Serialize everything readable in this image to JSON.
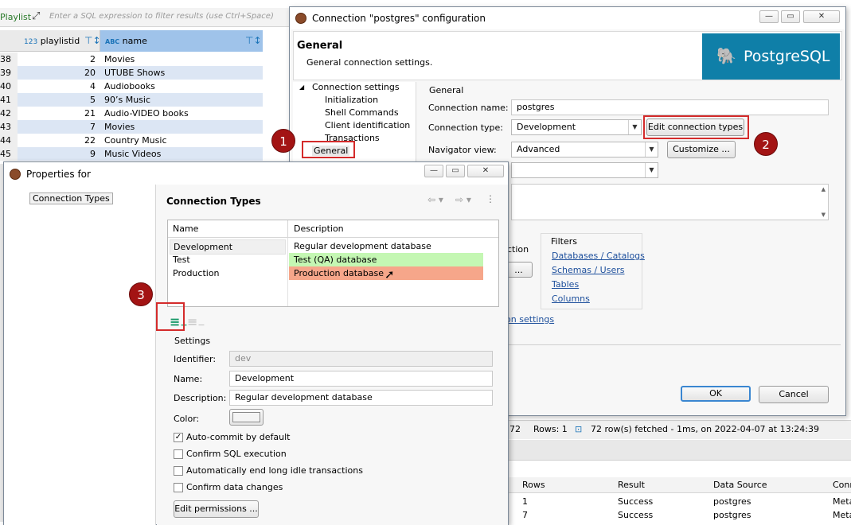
{
  "bg": {
    "playlist_tab": "Playlist",
    "filter_placeholder": "Enter a SQL expression to filter results (use Ctrl+Space)",
    "col_playlistid_type": "123",
    "col_playlistid": "playlistid",
    "col_name_type": "ABC",
    "col_name": "name",
    "rows": [
      {
        "num": "38",
        "id": "2",
        "name": "Movies"
      },
      {
        "num": "39",
        "id": "20",
        "name": "UTUBE Shows"
      },
      {
        "num": "40",
        "id": "4",
        "name": "Audiobooks"
      },
      {
        "num": "41",
        "id": "5",
        "name": "90’s Music"
      },
      {
        "num": "42",
        "id": "21",
        "name": "Audio-VIDEO books"
      },
      {
        "num": "43",
        "id": "7",
        "name": "Movies"
      },
      {
        "num": "44",
        "id": "22",
        "name": "Country Music"
      },
      {
        "num": "45",
        "id": "9",
        "name": "Music Videos"
      }
    ],
    "status_count": "72",
    "status_rows": "Rows: 1",
    "status_fetched": "72 row(s) fetched - 1ms, on 2022-04-07 at 13:24:39",
    "results_headers": [
      "Rows",
      "Result",
      "Data Source",
      "Conn"
    ],
    "results_rows": [
      {
        "rows": "1",
        "result": "Success",
        "source": "postgres",
        "conn": "Meta"
      },
      {
        "rows": "7",
        "result": "Success",
        "source": "postgres",
        "conn": "Meta"
      }
    ]
  },
  "conn_dialog": {
    "title": "Connection \"postgres\" configuration",
    "header_title": "General",
    "header_desc": "General connection settings.",
    "logo_text": "PostgreSQL",
    "nav": {
      "root": "Connection settings",
      "children": [
        "Initialization",
        "Shell Commands",
        "Client identification",
        "Transactions"
      ],
      "general": "General"
    },
    "group_title": "General",
    "conn_name_label": "Connection name:",
    "conn_name_value": "postgres",
    "conn_type_label": "Connection type:",
    "conn_type_value": "Development",
    "edit_types_button": "Edit connection types",
    "nav_view_label": "Navigator view:",
    "nav_view_value": "Advanced",
    "customize_button": "Customize ...",
    "partial_ction": "ction",
    "partial_dots_button": "...",
    "filters_title": "Filters",
    "filters": [
      "Databases / Catalogs",
      "Schemas / Users",
      "Tables",
      "Columns"
    ],
    "partial_link": "ion settings",
    "ok_button": "OK",
    "cancel_button": "Cancel"
  },
  "props_dialog": {
    "title": "Properties for",
    "nav_item": "Connection Types",
    "section_title": "Connection Types",
    "table_headers": [
      "Name",
      "Description"
    ],
    "types": [
      {
        "name": "Development",
        "desc": "Regular development database",
        "color": "#ffffff"
      },
      {
        "name": "Test",
        "desc": "Test (QA) database",
        "color": "#c4f7b3"
      },
      {
        "name": "Production",
        "desc": "Production database",
        "color": "#f6a68a"
      }
    ],
    "settings_title": "Settings",
    "identifier_label": "Identifier:",
    "identifier_value": "dev",
    "name_label": "Name:",
    "name_value": "Development",
    "desc_label": "Description:",
    "desc_value": "Regular development database",
    "color_label": "Color:",
    "checks": [
      {
        "label": "Auto-commit by default",
        "checked": true
      },
      {
        "label": "Confirm SQL execution",
        "checked": false
      },
      {
        "label": "Automatically end long idle transactions",
        "checked": false
      },
      {
        "label": "Confirm data changes",
        "checked": false
      }
    ],
    "edit_permissions_button": "Edit permissions ..."
  },
  "badges": [
    "1",
    "2",
    "3"
  ],
  "colors": {
    "accent": "#1a73b8",
    "red": "#d42b2b",
    "badge": "#a31414",
    "selected_row": "#dce6f4"
  }
}
